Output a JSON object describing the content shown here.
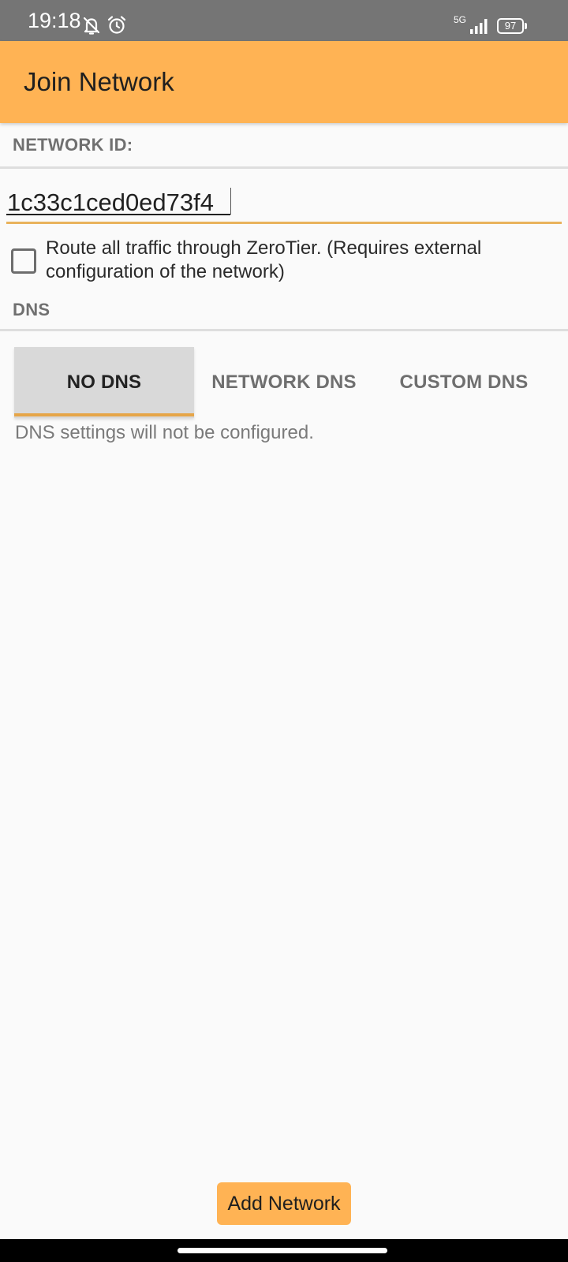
{
  "status_bar": {
    "time": "19:18",
    "network_type": "5G",
    "battery_level": "97",
    "icons": [
      "bell-off-icon",
      "alarm-icon",
      "signal-icon",
      "battery-icon"
    ]
  },
  "app_bar": {
    "title": "Join Network"
  },
  "network_id": {
    "label": "NETWORK ID:",
    "value": "1c33c1ced0ed73f4"
  },
  "route_all": {
    "checked": false,
    "label": "Route all traffic through ZeroTier. (Requires external configuration of the network)"
  },
  "dns": {
    "label": "DNS",
    "tabs": [
      {
        "label": "NO DNS",
        "selected": true
      },
      {
        "label": "NETWORK DNS",
        "selected": false
      },
      {
        "label": "CUSTOM DNS",
        "selected": false
      }
    ],
    "description": "DNS settings will not be configured."
  },
  "actions": {
    "add_network": "Add Network"
  },
  "colors": {
    "accent": "#ffb354",
    "status_bar": "#757575",
    "tab_indicator": "#e6a548",
    "background": "#fafafa"
  }
}
